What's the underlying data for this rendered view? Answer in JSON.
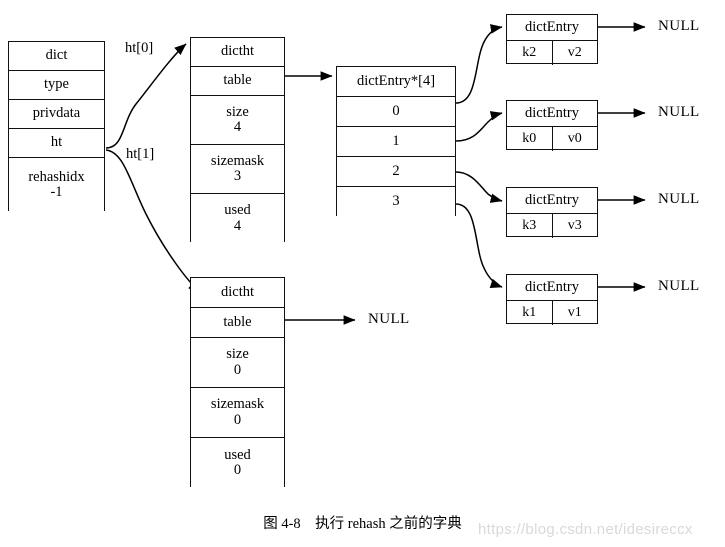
{
  "diagram": {
    "caption": "图 4-8　执行 rehash 之前的字典",
    "watermark": "https://blog.csdn.net/idesireccx",
    "dict_struct": {
      "title": "dict",
      "fields": [
        {
          "name": "type",
          "value": ""
        },
        {
          "name": "privdata",
          "value": ""
        },
        {
          "name": "ht",
          "value": ""
        },
        {
          "name": "rehashidx",
          "value": "-1"
        }
      ]
    },
    "pointer_labels": {
      "ht0": "ht[0]",
      "ht1": "ht[1]"
    },
    "ht0_table": {
      "title": "dictht",
      "fields": [
        {
          "name": "table",
          "value": ""
        },
        {
          "name": "size",
          "value": "4"
        },
        {
          "name": "sizemask",
          "value": "3"
        },
        {
          "name": "used",
          "value": "4"
        }
      ]
    },
    "ht1_table": {
      "title": "dictht",
      "fields": [
        {
          "name": "table",
          "value": ""
        },
        {
          "name": "size",
          "value": "0"
        },
        {
          "name": "sizemask",
          "value": "0"
        },
        {
          "name": "used",
          "value": "0"
        }
      ],
      "table_target": "NULL"
    },
    "bucket_array": {
      "title": "dictEntry*[4]",
      "slots": [
        "0",
        "1",
        "2",
        "3"
      ]
    },
    "entries": [
      {
        "title": "dictEntry",
        "key": "k2",
        "value": "v2",
        "next": "NULL"
      },
      {
        "title": "dictEntry",
        "key": "k0",
        "value": "v0",
        "next": "NULL"
      },
      {
        "title": "dictEntry",
        "key": "k3",
        "value": "v3",
        "next": "NULL"
      },
      {
        "title": "dictEntry",
        "key": "k1",
        "value": "v1",
        "next": "NULL"
      }
    ]
  }
}
